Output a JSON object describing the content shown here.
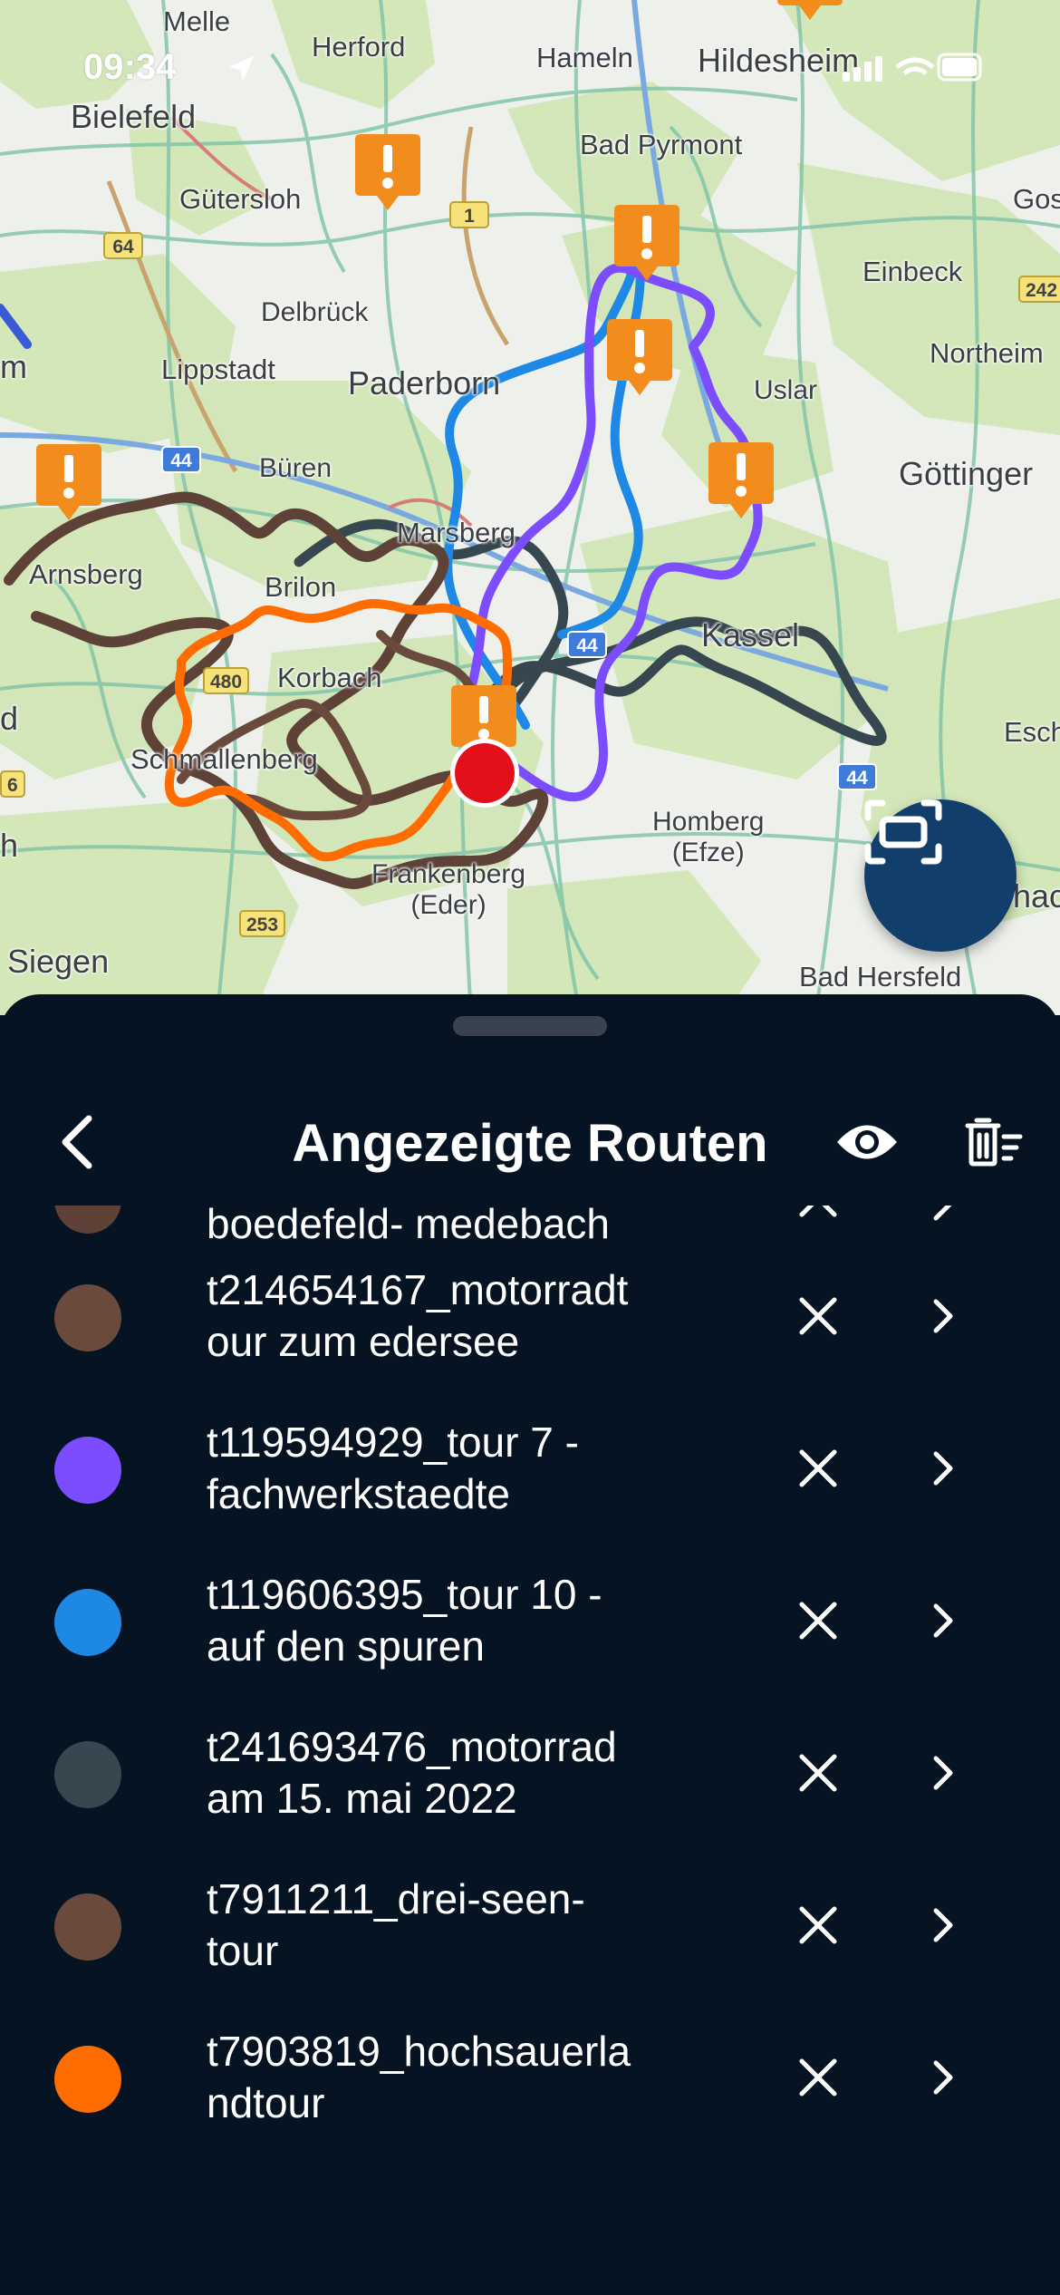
{
  "status_bar": {
    "time": "09:34"
  },
  "map": {
    "places": [
      {
        "id": "melle",
        "name": "Melle"
      },
      {
        "id": "herford",
        "name": "Herford"
      },
      {
        "id": "hameln",
        "name": "Hameln"
      },
      {
        "id": "hildesheim",
        "name": "Hildesheim"
      },
      {
        "id": "bielefeld",
        "name": "Bielefeld"
      },
      {
        "id": "bad_pyrmont",
        "name": "Bad Pyrmont"
      },
      {
        "id": "guetersloh",
        "name": "Gütersloh"
      },
      {
        "id": "gos",
        "name": "Gos"
      },
      {
        "id": "einbeck",
        "name": "Einbeck"
      },
      {
        "id": "delbrueck",
        "name": "Delbrück"
      },
      {
        "id": "northeim",
        "name": "Northeim"
      },
      {
        "id": "lippstadt",
        "name": "Lippstadt"
      },
      {
        "id": "paderborn",
        "name": "Paderborn"
      },
      {
        "id": "uslar",
        "name": "Uslar"
      },
      {
        "id": "m",
        "name": "m"
      },
      {
        "id": "bueren",
        "name": "Büren"
      },
      {
        "id": "goettingen",
        "name": "Göttinger"
      },
      {
        "id": "marsberg",
        "name": "Marsberg"
      },
      {
        "id": "arnsberg",
        "name": "Arnsberg"
      },
      {
        "id": "brilon",
        "name": "Brilon"
      },
      {
        "id": "kassel",
        "name": "Kassel"
      },
      {
        "id": "korbach",
        "name": "Korbach"
      },
      {
        "id": "d",
        "name": "d"
      },
      {
        "id": "schmallenberg",
        "name": "Schmallenberg"
      },
      {
        "id": "eschwe",
        "name": "Eschwe"
      },
      {
        "id": "homberg",
        "name": "Homberg\n(Efze)"
      },
      {
        "id": "h",
        "name": "h"
      },
      {
        "id": "frankenberg",
        "name": "Frankenberg\n(Eder)"
      },
      {
        "id": "hac",
        "name": "hac"
      },
      {
        "id": "siegen",
        "name": "Siegen"
      },
      {
        "id": "bad_hersfeld",
        "name": "Bad Hersfeld"
      }
    ],
    "road_shields": [
      {
        "id": "r1",
        "label": "1"
      },
      {
        "id": "r64",
        "label": "64"
      },
      {
        "id": "r242",
        "label": "242"
      },
      {
        "id": "a44a",
        "label": "44"
      },
      {
        "id": "r480",
        "label": "480"
      },
      {
        "id": "a44b",
        "label": "44"
      },
      {
        "id": "a44c",
        "label": "44"
      },
      {
        "id": "r253",
        "label": "253"
      },
      {
        "id": "r6",
        "label": "6"
      }
    ],
    "warning_icon": "exclamation-warning-icon",
    "location_marker": "current-location-icon"
  },
  "recenter_button": {
    "icon": "fit-bounds-icon"
  },
  "sheet": {
    "title": "Angezeigte Routen",
    "back_icon": "chevron-left-icon",
    "visibility_icon": "eye-icon",
    "clear_icon": "delete-all-icon",
    "routes": [
      {
        "name": "boedefeld- medebach",
        "color": "#5e4238"
      },
      {
        "name": "t214654167_motorradt\nour zum edersee",
        "color": "#6b4a3e"
      },
      {
        "name": "t119594929_tour 7 -\nfachwerkstaedte",
        "color": "#7c4dff"
      },
      {
        "name": "t119606395_tour 10 -\nauf den spuren",
        "color": "#1e88e5"
      },
      {
        "name": "t241693476_motorrad\nam 15. mai 2022",
        "color": "#37474f"
      },
      {
        "name": "t7911211_drei-seen-\ntour",
        "color": "#6b4a3e"
      },
      {
        "name": "t7903819_hochsauerla\nndtour",
        "color": "#ff6d00"
      }
    ]
  }
}
